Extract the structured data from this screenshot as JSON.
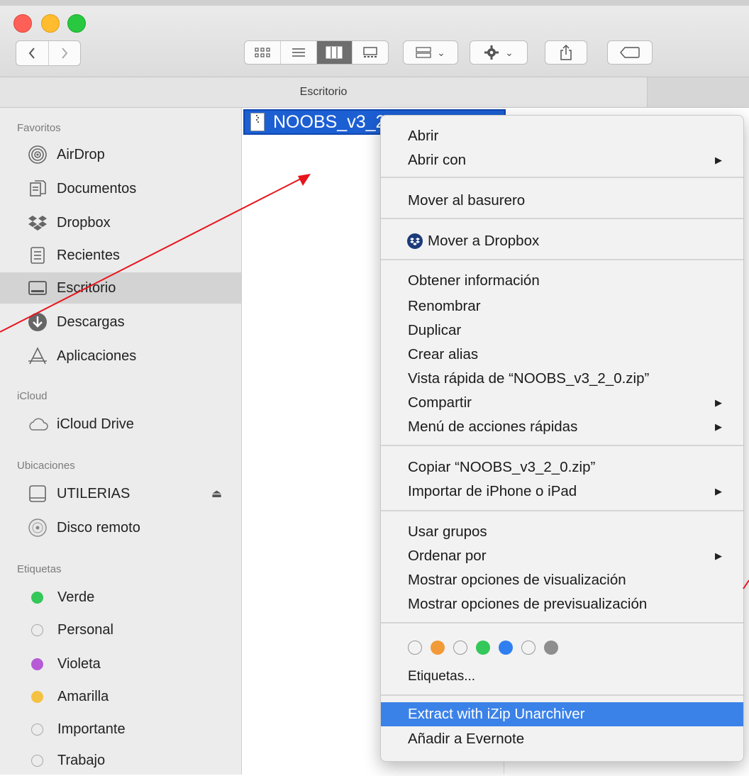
{
  "window": {
    "path_title": "Escritorio"
  },
  "toolbar": {
    "back_icon": "chevron-left",
    "forward_icon": "chevron-right",
    "views": [
      "icon-view",
      "list-view",
      "column-view",
      "gallery-view"
    ],
    "group_chevron": "⌄",
    "action_chevron": "⌄"
  },
  "sidebar": {
    "favorites_header": "Favoritos",
    "favorites": [
      {
        "label": "AirDrop",
        "icon": "airdrop-icon"
      },
      {
        "label": "Documentos",
        "icon": "documents-icon"
      },
      {
        "label": "Dropbox",
        "icon": "dropbox-icon"
      },
      {
        "label": "Recientes",
        "icon": "recents-icon"
      },
      {
        "label": "Escritorio",
        "icon": "desktop-icon",
        "selected": true
      },
      {
        "label": "Descargas",
        "icon": "downloads-icon"
      },
      {
        "label": "Aplicaciones",
        "icon": "applications-icon"
      }
    ],
    "icloud_header": "iCloud",
    "icloud": [
      {
        "label": "iCloud Drive",
        "icon": "cloud-icon"
      }
    ],
    "locations_header": "Ubicaciones",
    "locations": [
      {
        "label": "UTILERIAS",
        "icon": "drive-icon",
        "eject": "⏏"
      },
      {
        "label": "Disco remoto",
        "icon": "remote-disc-icon"
      }
    ],
    "tags_header": "Etiquetas",
    "tags": [
      {
        "label": "Verde",
        "color": "#34c759"
      },
      {
        "label": "Personal",
        "color": "none"
      },
      {
        "label": "Violeta",
        "color": "#b65ad6"
      },
      {
        "label": "Amarilla",
        "color": "#f5c142"
      },
      {
        "label": "Importante",
        "color": "none"
      },
      {
        "label": "Trabajo",
        "color": "none"
      }
    ]
  },
  "file": {
    "name": "NOOBS_v3_2_0.zip"
  },
  "context_menu": {
    "items": [
      {
        "label": "Abrir"
      },
      {
        "label": "Abrir con",
        "submenu": "▶"
      },
      {
        "label": "Mover al basurero"
      },
      {
        "label": "Mover a Dropbox",
        "icon": "dropbox-icon"
      },
      {
        "label": "Obtener información"
      },
      {
        "label": "Renombrar"
      },
      {
        "label": "Duplicar"
      },
      {
        "label": "Crear alias"
      },
      {
        "label": "Vista rápida de “NOOBS_v3_2_0.zip”"
      },
      {
        "label": "Compartir",
        "submenu": "▶"
      },
      {
        "label": "Menú de acciones rápidas",
        "submenu": "▶"
      },
      {
        "label": "Copiar “NOOBS_v3_2_0.zip”"
      },
      {
        "label": "Importar de iPhone o iPad",
        "submenu": "▶"
      },
      {
        "label": "Usar grupos"
      },
      {
        "label": "Ordenar por",
        "submenu": "▶"
      },
      {
        "label": "Mostrar opciones de visualización"
      },
      {
        "label": "Mostrar opciones de previsualización"
      },
      {
        "label": "Etiquetas..."
      },
      {
        "label": "Extract with iZip Unarchiver",
        "highlighted": true
      },
      {
        "label": "Añadir a Evernote"
      }
    ],
    "tag_colors": [
      "none",
      "#f29a38",
      "none",
      "#34c759",
      "#2f7ff0",
      "none",
      "#8e8e8e"
    ]
  },
  "annotation": {
    "arrow_color": "#e8141c"
  }
}
